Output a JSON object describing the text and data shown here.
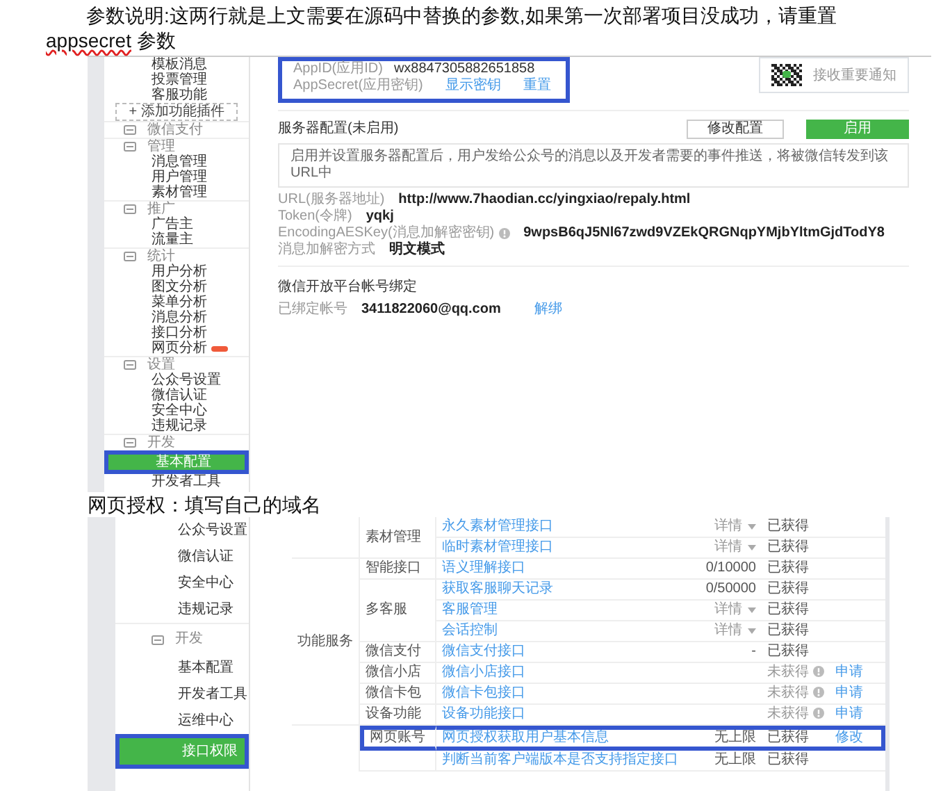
{
  "intro": {
    "segments": [
      {
        "text": "参数说明:这两行就是上文需要在源码中替换的参数,如果第一次部署项目没成功，请重置 ",
        "misspelled": false
      },
      {
        "text": "appsecret",
        "misspelled": true
      },
      {
        "text": " 参数",
        "misspelled": false
      }
    ]
  },
  "screenshot_1": {
    "sidebar": [
      {
        "kind": "link",
        "label": "模板消息",
        "selected": false
      },
      {
        "kind": "link",
        "label": "投票管理",
        "selected": false
      },
      {
        "kind": "link",
        "label": "客服功能",
        "selected": false
      },
      {
        "kind": "add_button",
        "label": "+ 添加功能插件"
      },
      {
        "kind": "heading",
        "label": "微信支付"
      },
      {
        "kind": "heading",
        "label": "管理"
      },
      {
        "kind": "link",
        "label": "消息管理",
        "selected": false
      },
      {
        "kind": "link",
        "label": "用户管理",
        "selected": false
      },
      {
        "kind": "link",
        "label": "素材管理",
        "selected": false
      },
      {
        "kind": "heading",
        "label": "推广"
      },
      {
        "kind": "link",
        "label": "广告主",
        "selected": false
      },
      {
        "kind": "link",
        "label": "流量主",
        "selected": false
      },
      {
        "kind": "heading",
        "label": "统计"
      },
      {
        "kind": "link",
        "label": "用户分析",
        "selected": false
      },
      {
        "kind": "link",
        "label": "图文分析",
        "selected": false
      },
      {
        "kind": "link",
        "label": "菜单分析",
        "selected": false
      },
      {
        "kind": "link",
        "label": "消息分析",
        "selected": false
      },
      {
        "kind": "link",
        "label": "接口分析",
        "selected": false
      },
      {
        "kind": "link",
        "label": "网页分析",
        "selected": false,
        "new_mark": true
      },
      {
        "kind": "heading",
        "label": "设置"
      },
      {
        "kind": "link",
        "label": "公众号设置",
        "selected": false
      },
      {
        "kind": "link",
        "label": "微信认证",
        "selected": false
      },
      {
        "kind": "link",
        "label": "安全中心",
        "selected": false
      },
      {
        "kind": "link",
        "label": "违规记录",
        "selected": false
      },
      {
        "kind": "heading",
        "label": "开发"
      },
      {
        "kind": "link",
        "label": "基本配置",
        "selected": true,
        "highlighted": true
      },
      {
        "kind": "link",
        "label": "开发者工具",
        "selected": false
      }
    ],
    "app_credentials": {
      "highlighted": true,
      "rows": [
        {
          "label": "AppID(应用ID)",
          "value": "wx8847305882651858"
        },
        {
          "label": "AppSecret(应用密钥)",
          "links": [
            "显示密钥",
            "重置"
          ]
        }
      ]
    },
    "notice": {
      "text": "接收重要通知"
    },
    "server_config": {
      "title": "服务器配置(未启用)",
      "buttons": [
        {
          "label": "修改配置",
          "primary": false
        },
        {
          "label": "启用",
          "primary": true
        }
      ],
      "info": "启用并设置服务器配置后，用户发给公众号的消息以及开发者需要的事件推送，将被微信转发到该URL中",
      "fields": [
        {
          "label": "URL(服务器地址)",
          "value": "http://www.7haodian.cc/yingxiao/repaly.html"
        },
        {
          "label": "Token(令牌)",
          "value": "yqkj"
        },
        {
          "label": "EncodingAESKey(消息加解密密钥)",
          "value": "9wpsB6qJ5Nl67zwd9VZEkQRGNqpYMjbYltmGjdTodY8",
          "help": true
        },
        {
          "label": "消息加解密方式",
          "value": "明文模式"
        }
      ]
    },
    "open_platform": {
      "title": "微信开放平台帐号绑定",
      "label": "已绑定帐号",
      "value": "3411822060@qq.com",
      "link": "解绑"
    }
  },
  "caption": "网页授权：填写自己的域名",
  "screenshot_2": {
    "sidebar": [
      {
        "kind": "link",
        "label": "公众号设置",
        "selected": false
      },
      {
        "kind": "link",
        "label": "微信认证",
        "selected": false
      },
      {
        "kind": "link",
        "label": "安全中心",
        "selected": false
      },
      {
        "kind": "link",
        "label": "违规记录",
        "selected": false
      },
      {
        "kind": "heading",
        "label": "开发"
      },
      {
        "kind": "link",
        "label": "基本配置",
        "selected": false
      },
      {
        "kind": "link",
        "label": "开发者工具",
        "selected": false
      },
      {
        "kind": "link",
        "label": "运维中心",
        "selected": false
      },
      {
        "kind": "link",
        "label": "接口权限",
        "selected": true,
        "highlighted": true
      }
    ],
    "table": {
      "groups": [
        {
          "subgroups": [
            {
              "label": "素材管理",
              "apis": [
                {
                  "name": "永久素材管理接口",
                  "quota": "详情",
                  "dropdown": true,
                  "status": "已获得",
                  "obtained": true
                },
                {
                  "name": "临时素材管理接口",
                  "quota": "详情",
                  "dropdown": true,
                  "status": "已获得",
                  "obtained": true
                }
              ]
            }
          ]
        },
        {
          "label": "功能服务",
          "subgroups": [
            {
              "label": "智能接口",
              "apis": [
                {
                  "name": "语义理解接口",
                  "quota": "0/10000",
                  "dropdown": false,
                  "status": "已获得",
                  "obtained": true
                }
              ]
            },
            {
              "label": "多客服",
              "apis": [
                {
                  "name": "获取客服聊天记录",
                  "quota": "0/50000",
                  "dropdown": false,
                  "status": "已获得",
                  "obtained": true
                },
                {
                  "name": "客服管理",
                  "quota": "详情",
                  "dropdown": true,
                  "status": "已获得",
                  "obtained": true
                },
                {
                  "name": "会话控制",
                  "quota": "详情",
                  "dropdown": true,
                  "status": "已获得",
                  "obtained": true
                }
              ]
            },
            {
              "label": "微信支付",
              "apis": [
                {
                  "name": "微信支付接口",
                  "quota": "-",
                  "dropdown": false,
                  "status": "已获得",
                  "obtained": true
                }
              ]
            },
            {
              "label": "微信小店",
              "apis": [
                {
                  "name": "微信小店接口",
                  "status": "未获得",
                  "obtained": false,
                  "action": "申请"
                }
              ]
            },
            {
              "label": "微信卡包",
              "apis": [
                {
                  "name": "微信卡包接口",
                  "status": "未获得",
                  "obtained": false,
                  "action": "申请"
                }
              ]
            },
            {
              "label": "设备功能",
              "apis": [
                {
                  "name": "设备功能接口",
                  "status": "未获得",
                  "obtained": false,
                  "action": "申请"
                }
              ]
            }
          ]
        },
        {
          "subgroups": [
            {
              "label": "网页账号",
              "apis": [
                {
                  "name": "网页授权获取用户基本信息",
                  "quota": "无上限",
                  "dropdown": false,
                  "status": "已获得",
                  "obtained": true,
                  "action": "修改",
                  "highlighted": true
                }
              ]
            },
            {
              "apis": [
                {
                  "name": "判断当前客户端版本是否支持指定接口",
                  "quota": "无上限",
                  "dropdown": false,
                  "status": "已获得",
                  "obtained": true
                }
              ]
            }
          ]
        }
      ]
    }
  }
}
